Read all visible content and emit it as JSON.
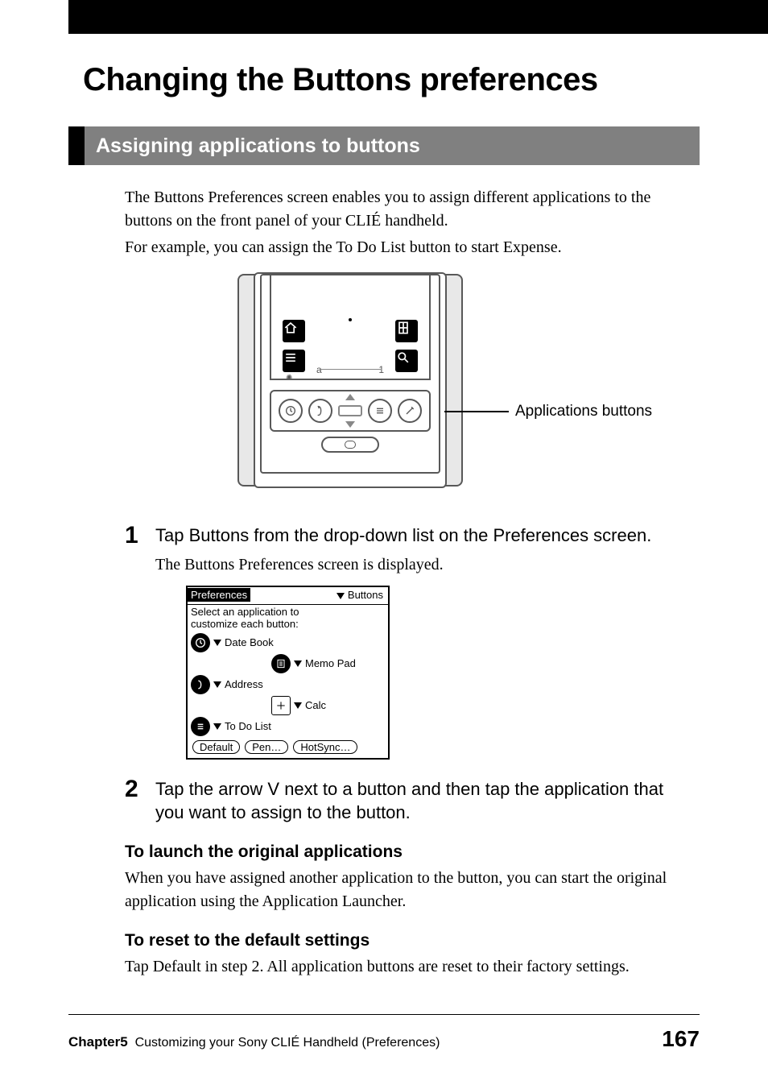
{
  "page": {
    "title": "Changing the Buttons preferences",
    "section_title": "Assigning applications to buttons",
    "intro_p1": "The Buttons Preferences screen enables you to assign different applications to the buttons on the front panel of your CLIÉ handheld.",
    "intro_p2": "For example, you can assign the To Do List button to start Expense.",
    "figure_callout": "Applications buttons",
    "steps": [
      {
        "num": "1",
        "title": "Tap Buttons from the drop-down list on the Preferences screen.",
        "sub": "The Buttons Preferences screen is displayed."
      },
      {
        "num": "2",
        "title": "Tap the arrow V next to a button and then tap the application that you want to assign to the button."
      }
    ],
    "screenshot": {
      "title": "Preferences",
      "menu": "Buttons",
      "instruction1": "Select an application to",
      "instruction2": "customize each button:",
      "items": [
        {
          "label": "Date Book"
        },
        {
          "label": "Memo Pad"
        },
        {
          "label": "Address"
        },
        {
          "label": "Calc"
        },
        {
          "label": "To Do List"
        }
      ],
      "buttons": [
        "Default",
        "Pen…",
        "HotSync…"
      ]
    },
    "sub1_heading": "To launch the original applications",
    "sub1_text": "When you have assigned another application to the button, you can start the original application using the Application Launcher.",
    "sub2_heading": "To reset to the default settings",
    "sub2_text": "Tap Default in step 2. All application buttons are reset to their factory settings.",
    "footer": {
      "chapter": "Chapter5",
      "chapter_title": "Customizing your Sony CLIÉ Handheld (Preferences)",
      "page": "167"
    }
  }
}
